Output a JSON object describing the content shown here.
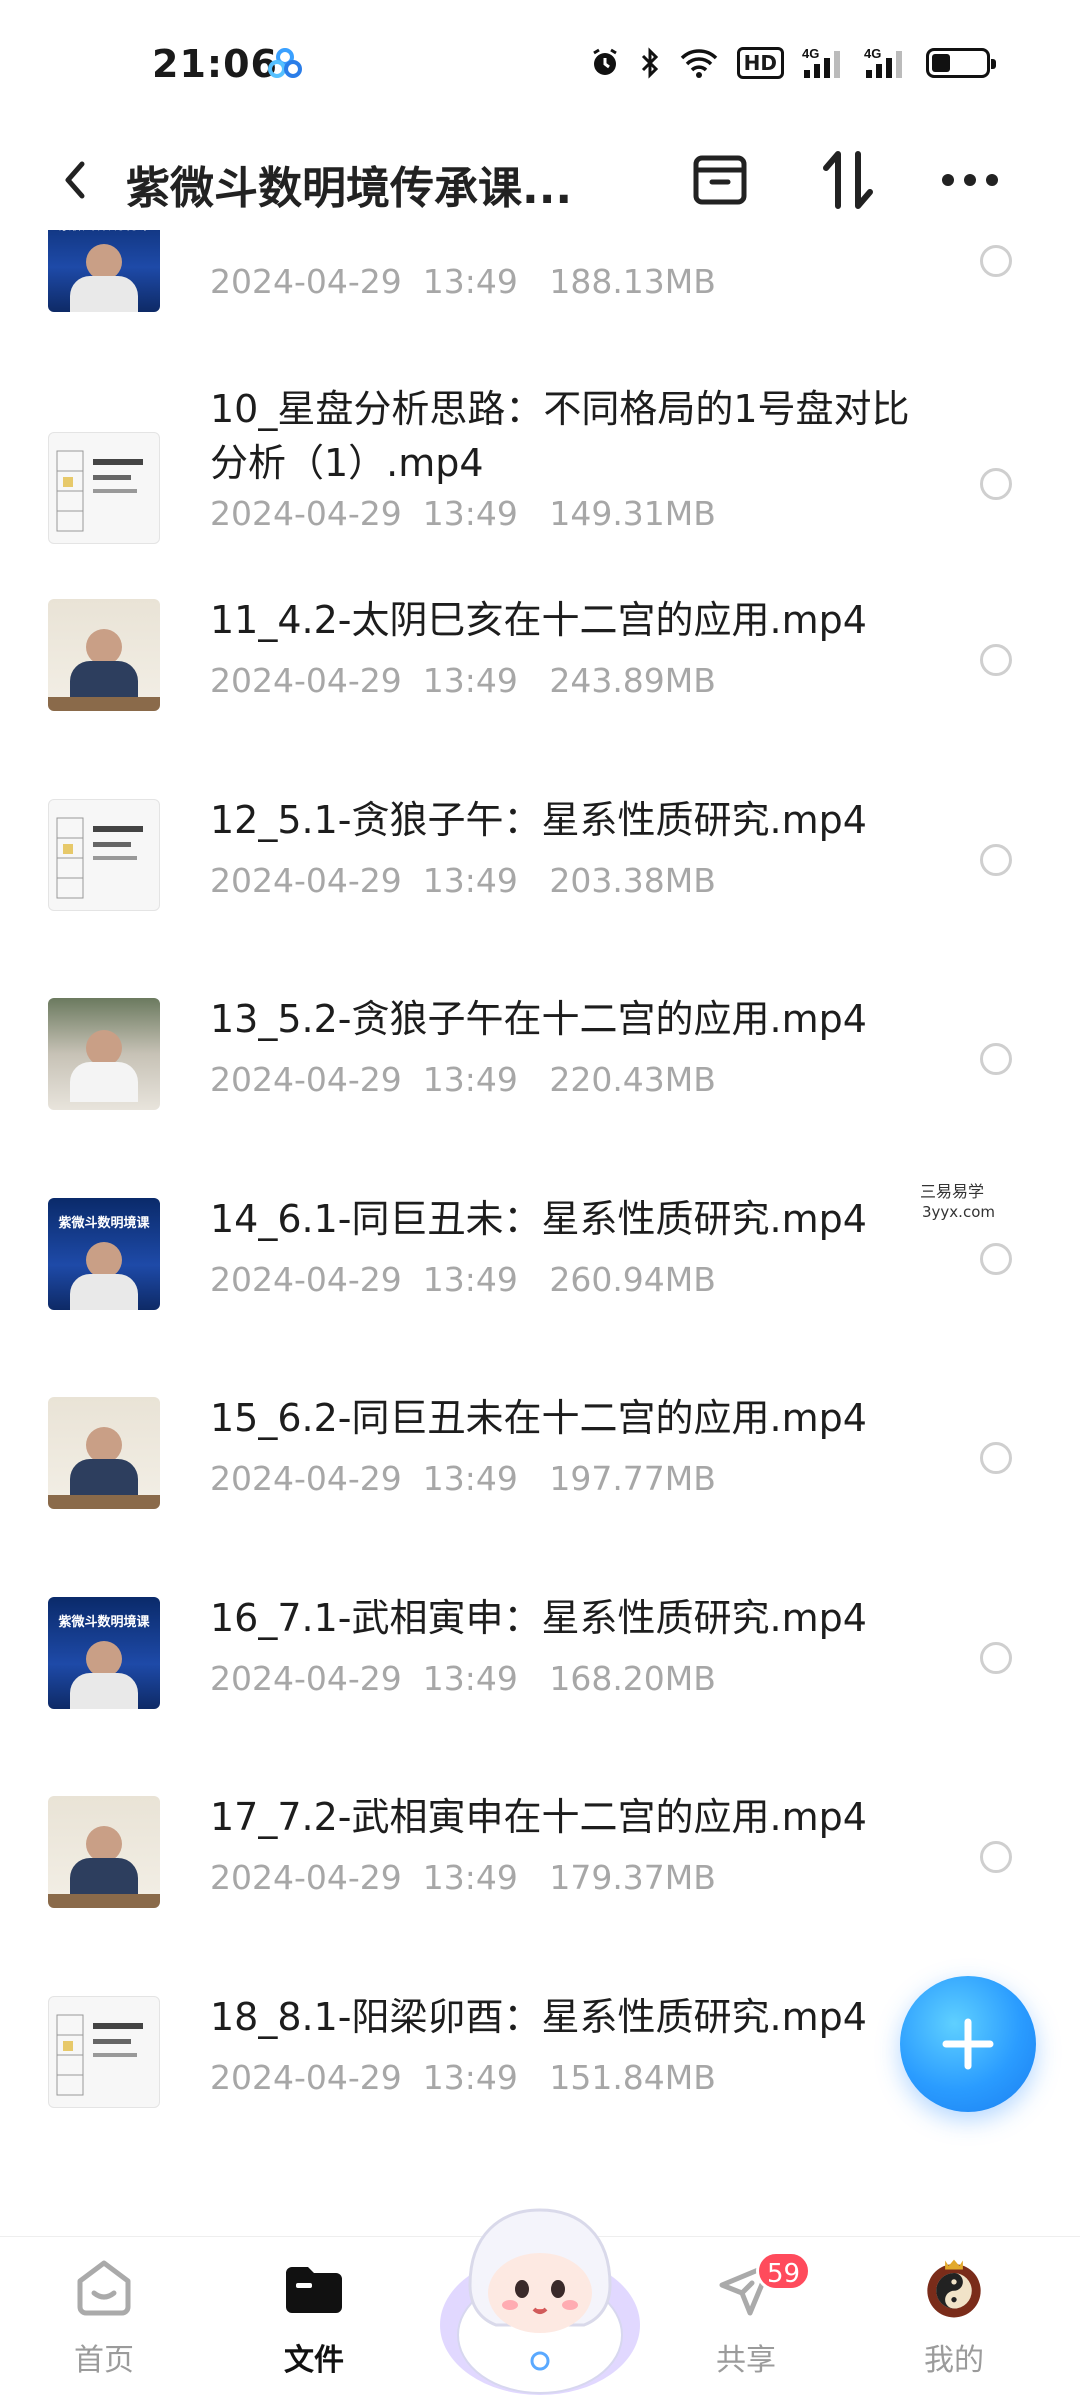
{
  "status_bar": {
    "time": "21:06",
    "network_badge": "HD",
    "signal_1": "4G",
    "signal_2": "4G",
    "battery_level": 0.3
  },
  "header": {
    "title": "紫微斗数明境传承课...",
    "icons": [
      "back-icon",
      "select-box-icon",
      "sort-icon",
      "more-icon"
    ]
  },
  "files": [
    {
      "name": "",
      "date": "2024-04-29",
      "time": "13:49",
      "size": "188.13MB",
      "thumb": "lecture-blue"
    },
    {
      "name": "10_星盘分析思路：不同格局的1号盘对比分析（1）.mp4",
      "date": "2024-04-29",
      "time": "13:49",
      "size": "149.31MB",
      "thumb": "doc"
    },
    {
      "name": "11_4.2-太阴巳亥在十二宫的应用.mp4",
      "date": "2024-04-29",
      "time": "13:49",
      "size": "243.89MB",
      "thumb": "lecture-light"
    },
    {
      "name": "12_5.1-贪狼子午：星系性质研究.mp4",
      "date": "2024-04-29",
      "time": "13:49",
      "size": "203.38MB",
      "thumb": "doc"
    },
    {
      "name": "13_5.2-贪狼子午在十二宫的应用.mp4",
      "date": "2024-04-29",
      "time": "13:49",
      "size": "220.43MB",
      "thumb": "library"
    },
    {
      "name": "14_6.1-同巨丑未：星系性质研究.mp4",
      "date": "2024-04-29",
      "time": "13:49",
      "size": "260.94MB",
      "thumb": "lecture-blue"
    },
    {
      "name": "15_6.2-同巨丑未在十二宫的应用.mp4",
      "date": "2024-04-29",
      "time": "13:49",
      "size": "197.77MB",
      "thumb": "lecture-light"
    },
    {
      "name": "16_7.1-武相寅申：星系性质研究.mp4",
      "date": "2024-04-29",
      "time": "13:49",
      "size": "168.20MB",
      "thumb": "lecture-blue"
    },
    {
      "name": "17_7.2-武相寅申在十二宫的应用.mp4",
      "date": "2024-04-29",
      "time": "13:49",
      "size": "179.37MB",
      "thumb": "lecture-light"
    },
    {
      "name": "18_8.1-阳梁卯酉：星系性质研究.mp4",
      "date": "2024-04-29",
      "time": "13:49",
      "size": "151.84MB",
      "thumb": "doc"
    }
  ],
  "thumb_caption": "紫微斗数明境课",
  "watermark": {
    "line1": "三易易学",
    "line2": "3yyx.com"
  },
  "bottom_nav": {
    "home": "首页",
    "files": "文件",
    "share": "共享",
    "share_badge": "59",
    "mine": "我的"
  },
  "colors": {
    "accent": "#2a9cff",
    "badge": "#ff4b5c",
    "meta_text": "#a7a7a7"
  }
}
